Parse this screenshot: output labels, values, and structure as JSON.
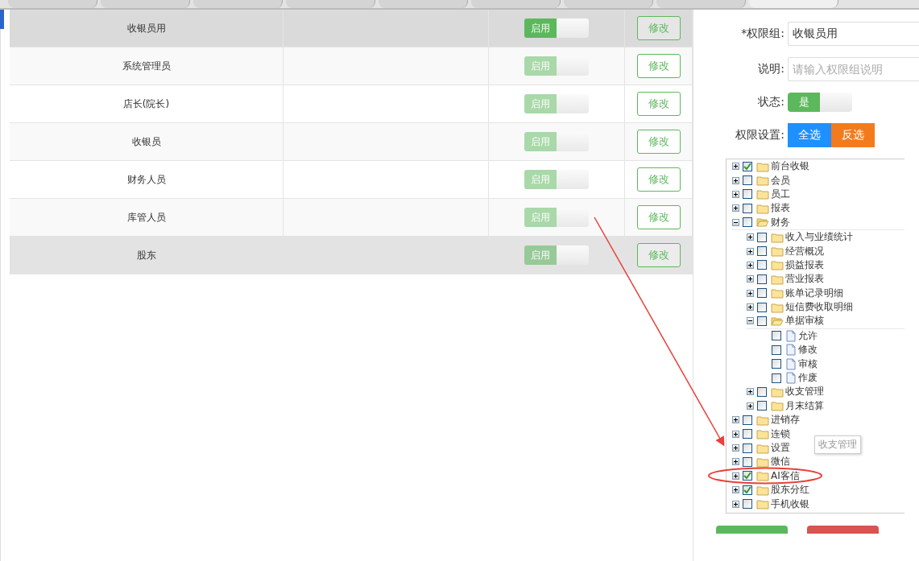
{
  "tabs": [
    {
      "selected": false
    },
    {
      "selected": false
    },
    {
      "selected": false
    },
    {
      "selected": false
    },
    {
      "selected": false
    },
    {
      "selected": false
    },
    {
      "selected": false
    },
    {
      "selected": false
    },
    {
      "selected": true
    }
  ],
  "roles": [
    {
      "name": "收银员用",
      "toggle_label": "启用",
      "enabled": true,
      "selected": true,
      "hovered": false,
      "edit_label": "修改"
    },
    {
      "name": "系统管理员",
      "toggle_label": "启用",
      "enabled": true,
      "selected": false,
      "hovered": false,
      "edit_label": "修改"
    },
    {
      "name": "店长(院长)",
      "toggle_label": "启用",
      "enabled": true,
      "selected": false,
      "hovered": false,
      "edit_label": "修改"
    },
    {
      "name": "收银员",
      "toggle_label": "启用",
      "enabled": true,
      "selected": false,
      "hovered": false,
      "edit_label": "修改"
    },
    {
      "name": "财务人员",
      "toggle_label": "启用",
      "enabled": true,
      "selected": false,
      "hovered": false,
      "edit_label": "修改"
    },
    {
      "name": "库管人员",
      "toggle_label": "启用",
      "enabled": true,
      "selected": false,
      "hovered": false,
      "edit_label": "修改"
    },
    {
      "name": "股东",
      "toggle_label": "启用",
      "enabled": true,
      "selected": false,
      "hovered": true,
      "edit_label": "修改"
    }
  ],
  "form": {
    "group_label": "*权限组:",
    "group_value": "收银员用",
    "desc_label": "说明:",
    "desc_placeholder": "请输入权限组说明",
    "status_label": "状态:",
    "status_toggle": "是",
    "status_on": true,
    "perm_label": "权限设置:",
    "select_all": "全选",
    "invert": "反选"
  },
  "tree": [
    {
      "kind": "folder",
      "label": "前台收银",
      "checked": true,
      "expanded": false
    },
    {
      "kind": "folder",
      "label": "会员",
      "checked": false,
      "expanded": false
    },
    {
      "kind": "folder",
      "label": "员工",
      "checked": false,
      "expanded": false
    },
    {
      "kind": "folder",
      "label": "报表",
      "checked": false,
      "expanded": false
    },
    {
      "kind": "folder",
      "label": "财务",
      "checked": false,
      "expanded": true,
      "children": [
        {
          "kind": "folder",
          "label": "收入与业绩统计",
          "checked": false,
          "expanded": false
        },
        {
          "kind": "folder",
          "label": "经营概况",
          "checked": false,
          "expanded": false
        },
        {
          "kind": "folder",
          "label": "损益报表",
          "checked": false,
          "expanded": false
        },
        {
          "kind": "folder",
          "label": "营业报表",
          "checked": false,
          "expanded": false
        },
        {
          "kind": "folder",
          "label": "账单记录明细",
          "checked": false,
          "expanded": false
        },
        {
          "kind": "folder",
          "label": "短信费收取明细",
          "checked": false,
          "expanded": false
        },
        {
          "kind": "folder",
          "label": "单据审核",
          "checked": false,
          "expanded": true,
          "children": [
            {
              "kind": "file",
              "label": "允许",
              "checked": false
            },
            {
              "kind": "file",
              "label": "修改",
              "checked": false
            },
            {
              "kind": "file",
              "label": "审核",
              "checked": false
            },
            {
              "kind": "file",
              "label": "作废",
              "checked": false
            }
          ]
        },
        {
          "kind": "folder",
          "label": "收支管理",
          "checked": false,
          "expanded": false
        },
        {
          "kind": "folder",
          "label": "月末结算",
          "checked": false,
          "expanded": false
        }
      ]
    },
    {
      "kind": "folder",
      "label": "进销存",
      "checked": false,
      "expanded": false
    },
    {
      "kind": "folder",
      "label": "连锁",
      "checked": false,
      "expanded": false
    },
    {
      "kind": "folder",
      "label": "设置",
      "checked": false,
      "expanded": false
    },
    {
      "kind": "folder",
      "label": "微信",
      "checked": false,
      "expanded": false
    },
    {
      "kind": "folder",
      "label": "AI客信",
      "checked": true,
      "expanded": false
    },
    {
      "kind": "folder",
      "label": "股东分红",
      "checked": true,
      "expanded": false
    },
    {
      "kind": "folder",
      "label": "手机收银",
      "checked": false,
      "expanded": false
    }
  ],
  "tooltip": "收支管理"
}
